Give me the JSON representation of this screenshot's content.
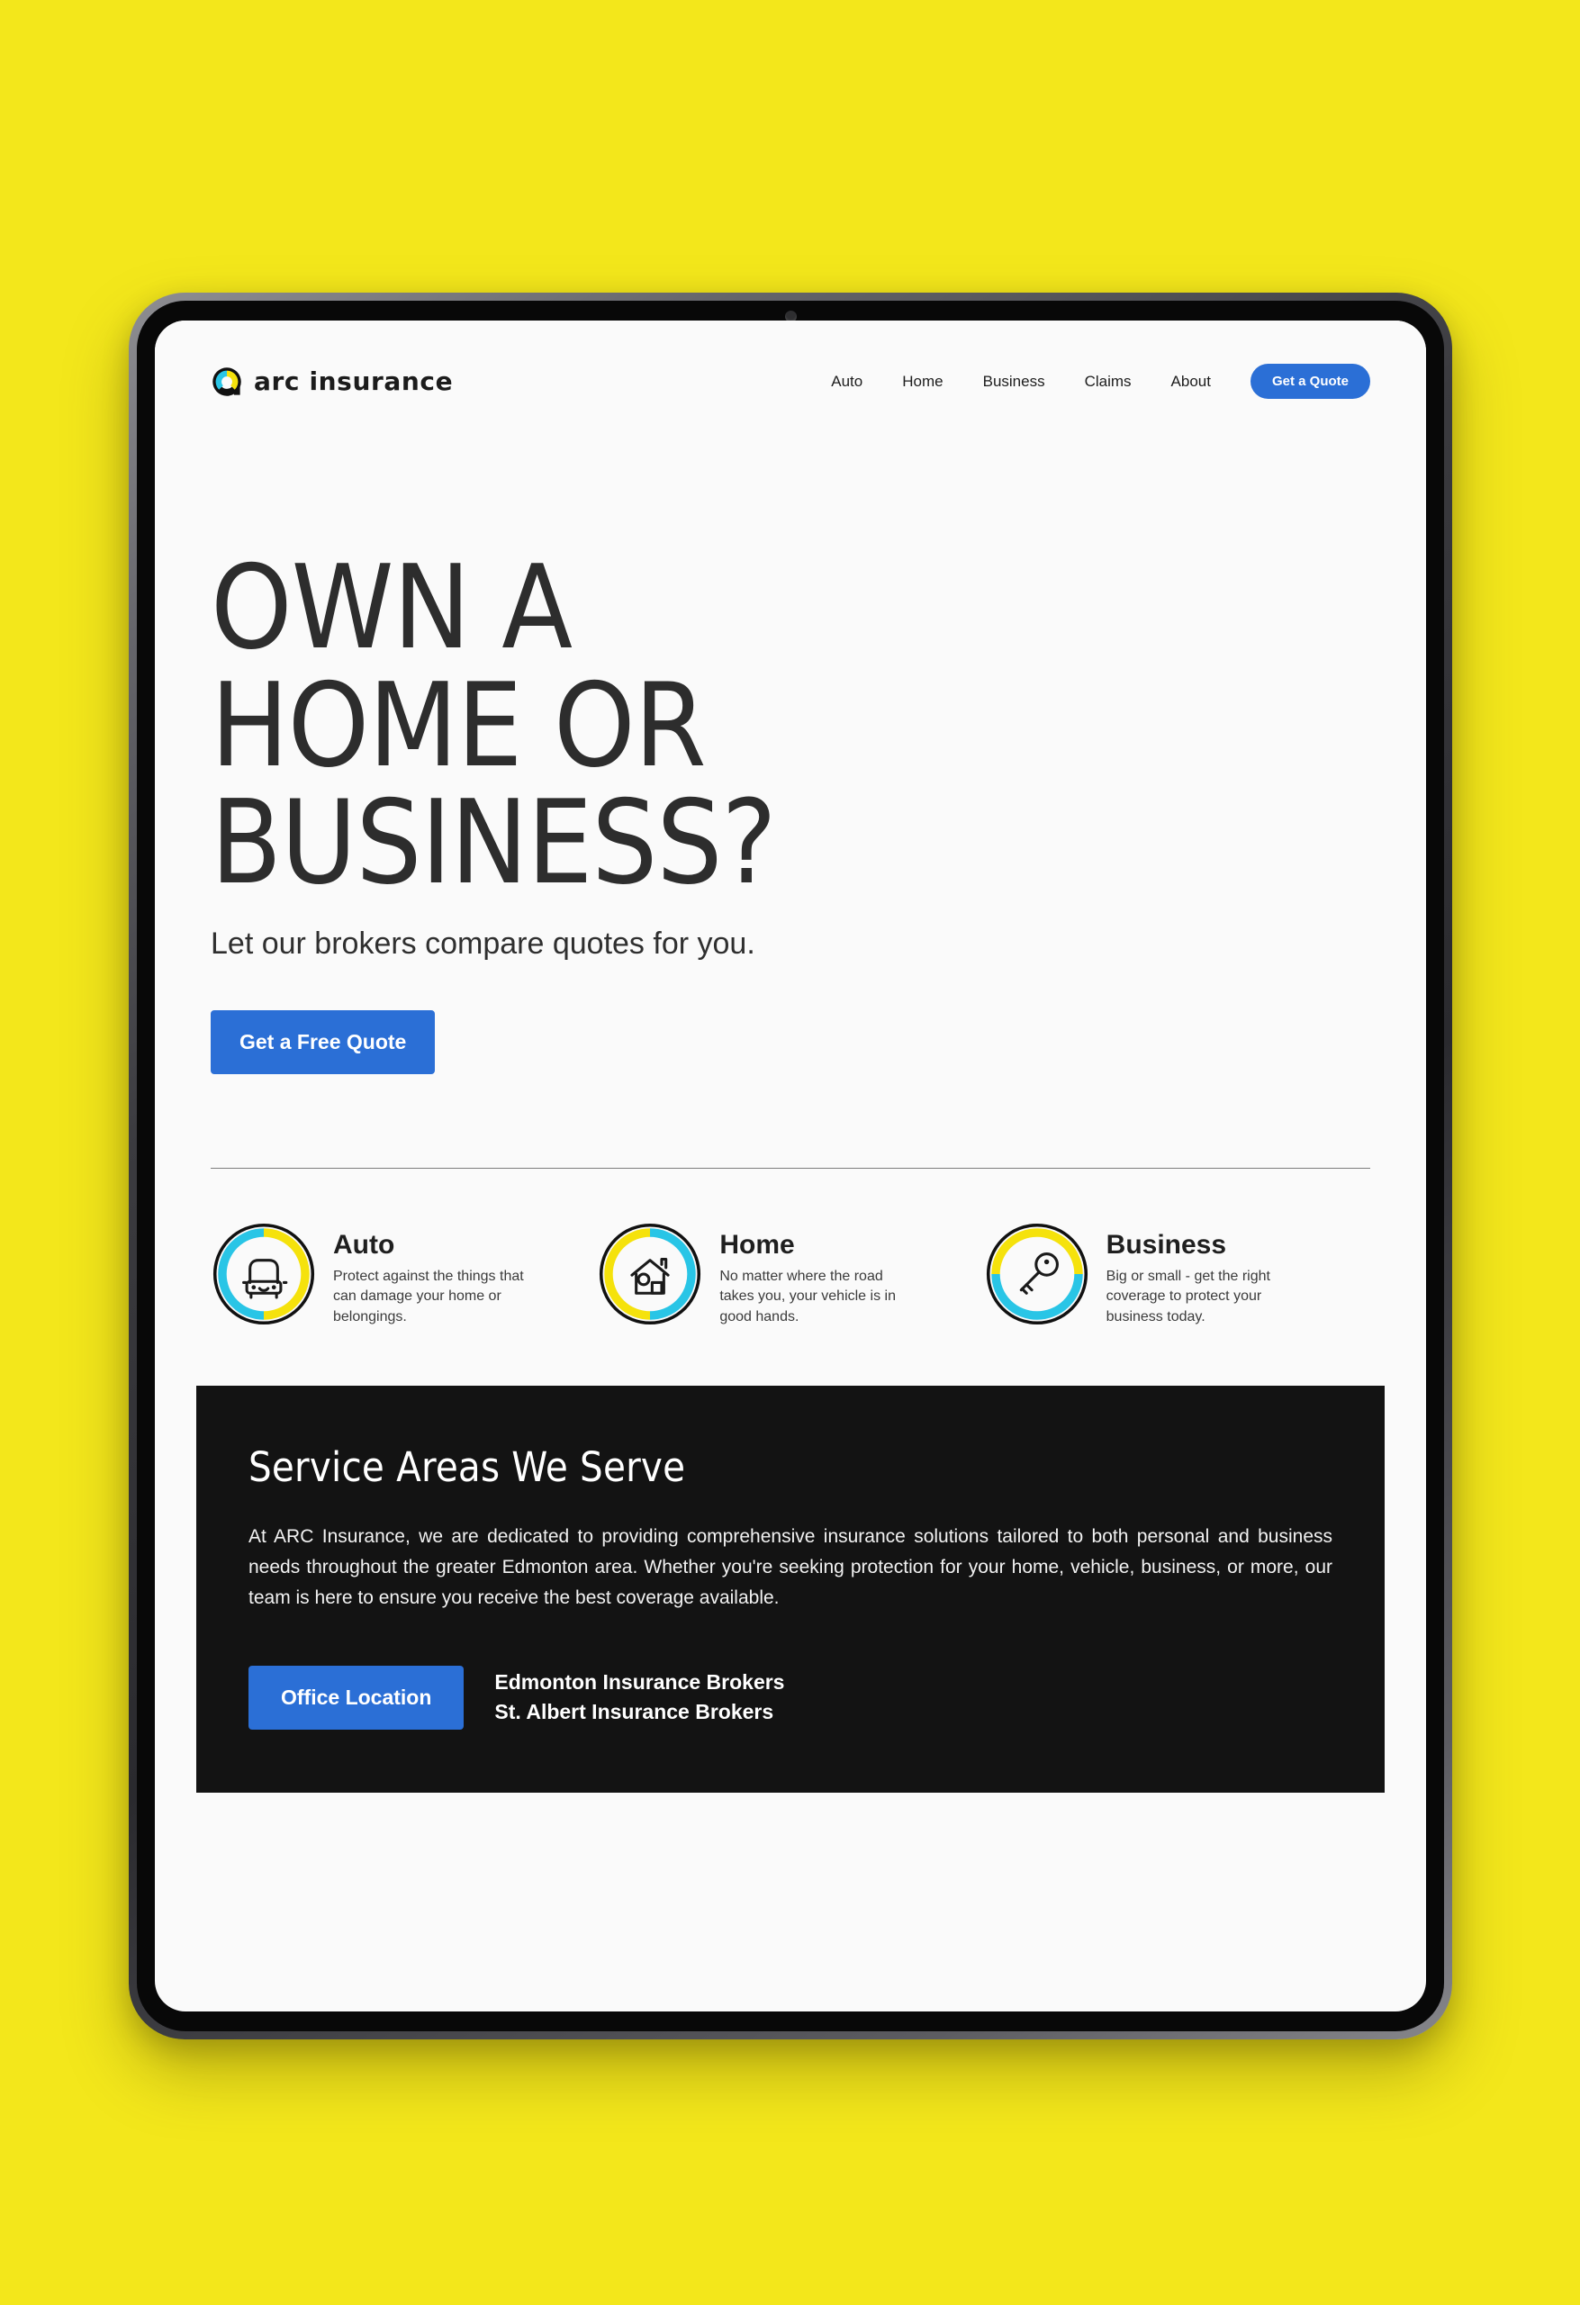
{
  "background_color": "#f3e71b",
  "brand": {
    "name": "arc insurance",
    "mark_colors": {
      "cyan": "#29c5e6",
      "yellow": "#f5e20c",
      "dark": "#111111"
    }
  },
  "nav": {
    "items": [
      {
        "label": "Auto"
      },
      {
        "label": "Home"
      },
      {
        "label": "Business"
      },
      {
        "label": "Claims"
      },
      {
        "label": "About"
      }
    ],
    "cta_label": "Get a Quote",
    "cta_color": "#2b6fd6"
  },
  "hero": {
    "title": "OWN A\nHOME OR\nBUSINESS?",
    "subtitle": "Let our brokers compare quotes for you.",
    "button_label": "Get a Free Quote"
  },
  "features": [
    {
      "icon": "car-icon",
      "title": "Auto",
      "description": "Protect against the things that can damage your home or belongings.",
      "ring": {
        "left": "#29c5e6",
        "right": "#f5e20c"
      }
    },
    {
      "icon": "house-icon",
      "title": "Home",
      "description": "No matter where the road takes you, your vehicle is in good hands.",
      "ring": {
        "left": "#f5e20c",
        "right": "#29c5e6"
      }
    },
    {
      "icon": "key-icon",
      "title": "Business",
      "description": "Big or small - get the right coverage to protect your business today.",
      "ring": {
        "left": "#f5e20c",
        "right": "#29c5e6"
      }
    }
  ],
  "service_section": {
    "title": "Service Areas We Serve",
    "body": "At ARC Insurance, we are dedicated to providing comprehensive insurance solutions tailored to both personal and business needs throughout the greater Edmonton area. Whether you're seeking protection for your home, vehicle, business, or more, our team is here to ensure you receive the best coverage available.",
    "button_label": "Office Location",
    "links": [
      {
        "label": "Edmonton Insurance Brokers"
      },
      {
        "label": "St. Albert Insurance Brokers"
      }
    ],
    "background_color": "#131313"
  }
}
